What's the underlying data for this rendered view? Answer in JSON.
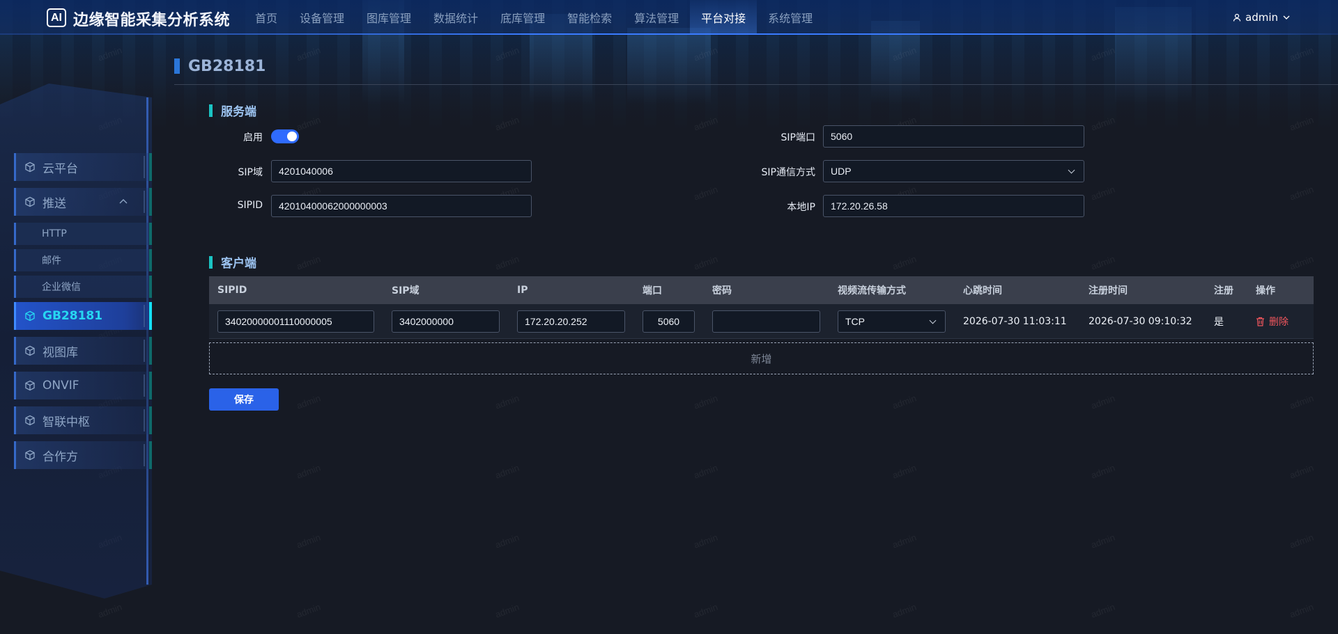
{
  "header": {
    "logo_text": "AI",
    "app_title": "边缘智能采集分析系统",
    "nav": [
      "首页",
      "设备管理",
      "图库管理",
      "数据统计",
      "底库管理",
      "智能检索",
      "算法管理",
      "平台对接",
      "系统管理"
    ],
    "active_nav": "平台对接",
    "user": "admin"
  },
  "sidebar": {
    "items": [
      {
        "label": "云平台"
      },
      {
        "label": "推送",
        "expanded": true
      },
      {
        "label": "HTTP",
        "sub": true
      },
      {
        "label": "邮件",
        "sub": true
      },
      {
        "label": "企业微信",
        "sub": true
      },
      {
        "label": "GB28181",
        "active": true
      },
      {
        "label": "视图库"
      },
      {
        "label": "ONVIF"
      },
      {
        "label": "智联中枢"
      },
      {
        "label": "合作方"
      }
    ]
  },
  "page": {
    "title": "GB28181"
  },
  "server": {
    "section_title": "服务端",
    "enable_label": "启用",
    "enabled": true,
    "sip_domain_label": "SIP域",
    "sip_domain": "4201040006",
    "sipid_label": "SIPID",
    "sipid": "42010400062000000003",
    "sip_port_label": "SIP端口",
    "sip_port": "5060",
    "sip_transport_label": "SIP通信方式",
    "sip_transport": "UDP",
    "local_ip_label": "本地IP",
    "local_ip": "172.20.26.58"
  },
  "client": {
    "section_title": "客户端",
    "columns": [
      "SIPID",
      "SIP域",
      "IP",
      "端口",
      "密码",
      "视频流传输方式",
      "心跳时间",
      "注册时间",
      "注册",
      "操作"
    ],
    "rows": [
      {
        "sipid": "34020000001110000005",
        "sip_domain": "3402000000",
        "ip": "172.20.20.252",
        "port": "5060",
        "password": "",
        "transport": "TCP",
        "heartbeat": "2026-07-30 11:03:11",
        "register_time": "2026-07-30 09:10:32",
        "registered": "是",
        "action": "删除"
      }
    ],
    "add_label": "新增"
  },
  "save_label": "保存",
  "watermark": "admin",
  "colors": {
    "accent": "#2a62e8",
    "active_sidebar_text": "#27d7f1",
    "delete": "#f0565d",
    "section_bar": "#1bc4c4"
  }
}
